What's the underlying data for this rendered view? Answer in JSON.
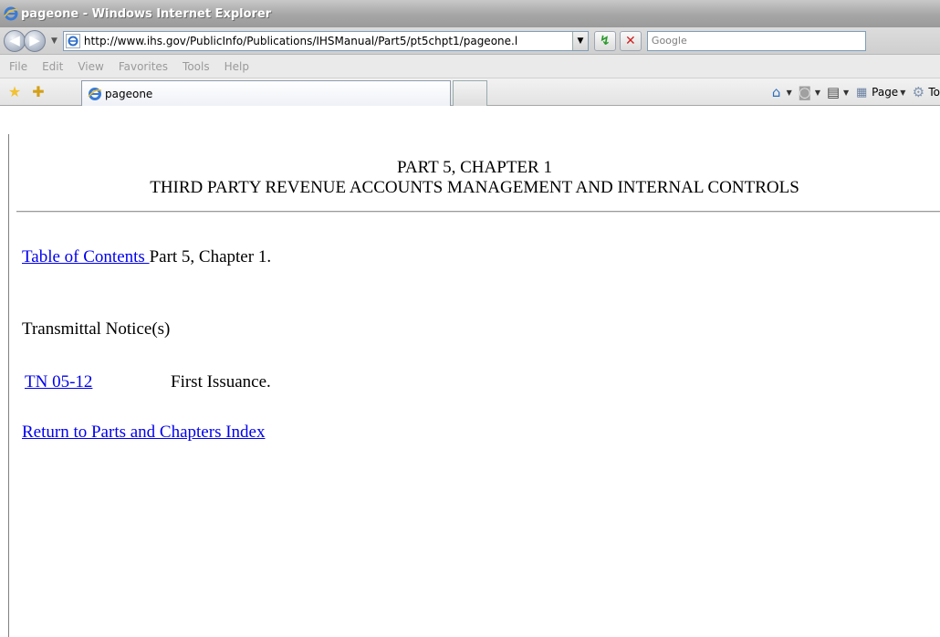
{
  "window": {
    "title": "pageone - Windows Internet Explorer"
  },
  "address_bar": {
    "url": "http://www.ihs.gov/PublicInfo/Publications/IHSManual/Part5/pt5chpt1/pageone.l",
    "search_placeholder": "Google"
  },
  "menu": {
    "items": [
      "File",
      "Edit",
      "View",
      "Favorites",
      "Tools",
      "Help"
    ]
  },
  "tabs": {
    "active_title": "pageone"
  },
  "command_bar": {
    "page_label": "Page",
    "tools_label": "To"
  },
  "page": {
    "heading_line1": "PART 5, CHAPTER 1",
    "heading_line2": "THIRD PARTY REVENUE ACCOUNTS MANAGEMENT AND INTERNAL CONTROLS",
    "toc_link": "Table of Contents ",
    "toc_suffix": "Part 5, Chapter 1.",
    "transmittal_heading": "Transmittal Notice(s)",
    "tn_link": "TN 05-12",
    "tn_description": "First Issuance.",
    "return_link": "Return to Parts and Chapters Index"
  }
}
